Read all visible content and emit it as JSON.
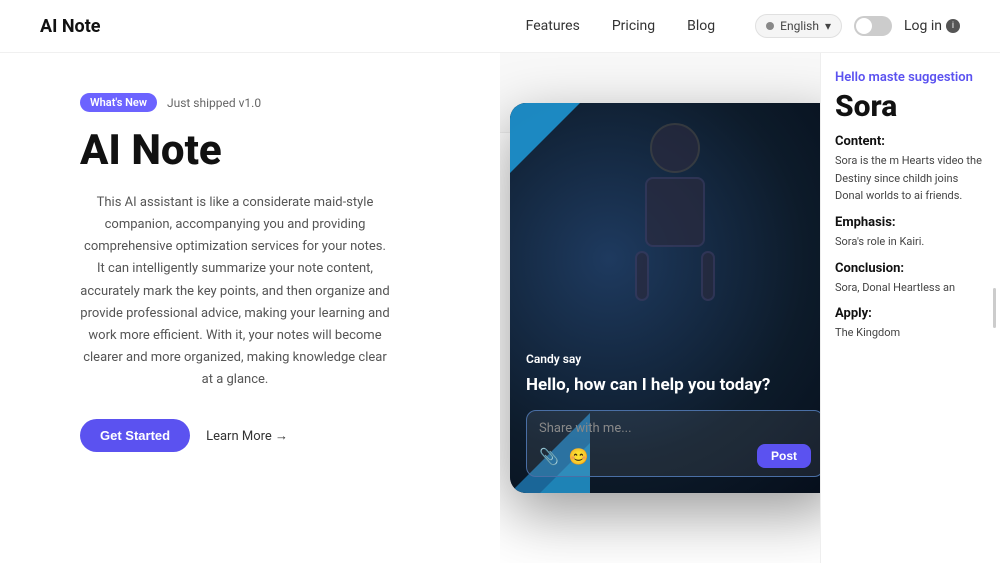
{
  "navbar": {
    "logo": "AI Note",
    "links": [
      {
        "label": "Features",
        "id": "features"
      },
      {
        "label": "Pricing",
        "id": "pricing"
      },
      {
        "label": "Blog",
        "id": "blog"
      }
    ],
    "language": "English",
    "login_label": "Log in"
  },
  "hero": {
    "badge_new": "What's New",
    "badge_version": "Just shipped v1.0",
    "title": "AI Note",
    "description": "This AI assistant is like a considerate maid-style companion, accompanying you and providing comprehensive optimization services for your notes. It can intelligently summarize your note content, accurately mark the key points, and then organize and provide professional advice, making your learning and work more efficient. With it, your notes will become clearer and more organized, making knowledge clear at a glance.",
    "btn_get_started": "Get Started",
    "btn_learn_more": "Learn More →"
  },
  "chat": {
    "sender_label": "Candy",
    "sender_suffix": "say",
    "message": "Hello, how can I help you today?",
    "input_placeholder": "Share with me...",
    "post_button": "Post"
  },
  "right_panel": {
    "hello_text": "Hello maste suggestion",
    "title": "Sora",
    "content_label": "Content:",
    "content_text": "Sora is the m Hearts video the Destiny since childh joins Donal worlds to ai friends.",
    "emphasis_label": "Emphasis:",
    "emphasis_text": "Sora's role in Kairi.",
    "conclusion_label": "Conclusion:",
    "conclusion_text": "Sora, Donal Heartless an",
    "apply_label": "Apply:",
    "apply_text": "The Kingdom"
  }
}
